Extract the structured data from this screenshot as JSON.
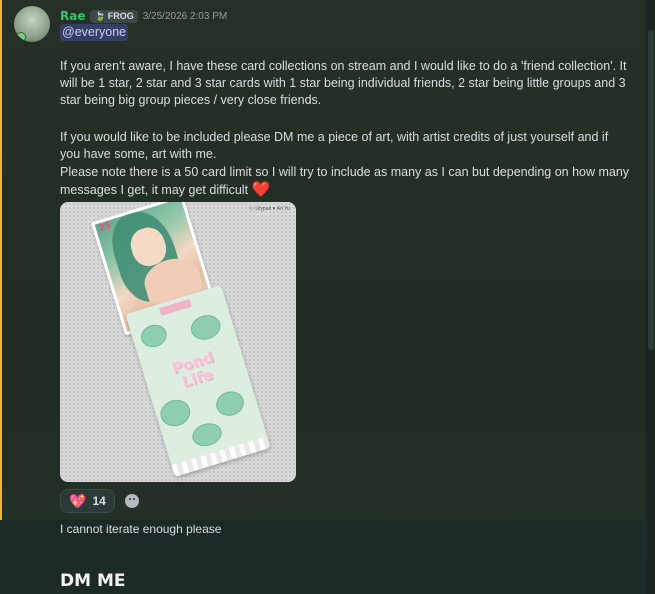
{
  "message": {
    "username": "Rae",
    "tag": {
      "icon": "leaf-icon",
      "label": "FROG"
    },
    "timestamp": "3/25/2026 2:03 PM",
    "mention": "@everyone",
    "paragraph1": "If you aren't aware, I have these card collections on stream and I would like to do a 'friend collection'. It will be 1 star, 2 star and 3 star cards with 1 star being individual friends, 2 star being little groups and 3 star being big group pieces / very close friends.",
    "paragraph2": "If you would like to be included please DM me a piece of art, with artist credits of just yourself and if you have some, art with me.",
    "paragraph3": "Please note there is a 50 card limit so I will try to include as many as I can but depending on how many messages I get, it may get difficult",
    "heart_emoji": "❤️",
    "attachment": {
      "watermark": "ⓒ Lilypad ♥ Ari Yu",
      "card_number_top": "25",
      "card_number_bottom": "25",
      "card_back_title_line1": "Pond",
      "card_back_title_line2": "Life"
    },
    "reactions": [
      {
        "emoji": "💖",
        "count": "14"
      }
    ]
  },
  "followups": {
    "msg2": "I cannot iterate enough please",
    "msg3": "DM ME"
  },
  "colors": {
    "username": "#2dc770",
    "mention_bar": "#f0b232",
    "heart": "#e3263c"
  }
}
